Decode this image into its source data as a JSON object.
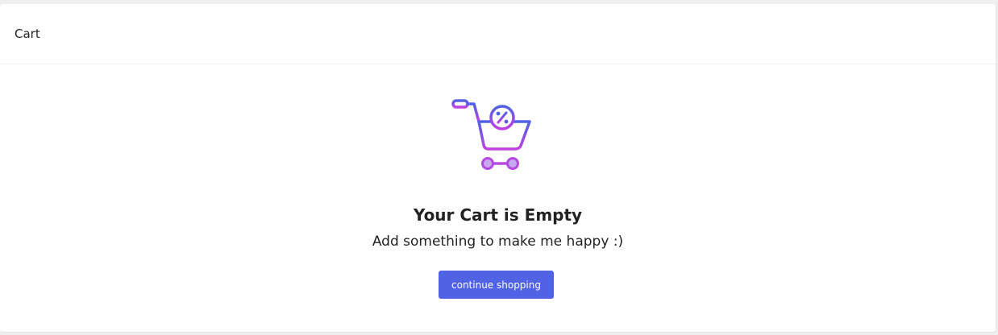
{
  "header": {
    "title": "Cart"
  },
  "empty_state": {
    "icon": "shopping-cart-discount-icon",
    "title": "Your Cart is Empty",
    "subtitle": "Add something to make me happy :)",
    "button_label": "continue shopping"
  },
  "colors": {
    "accent": "#4f63e4",
    "icon_gradient_start": "#4f63e4",
    "icon_gradient_end": "#c040e0"
  }
}
